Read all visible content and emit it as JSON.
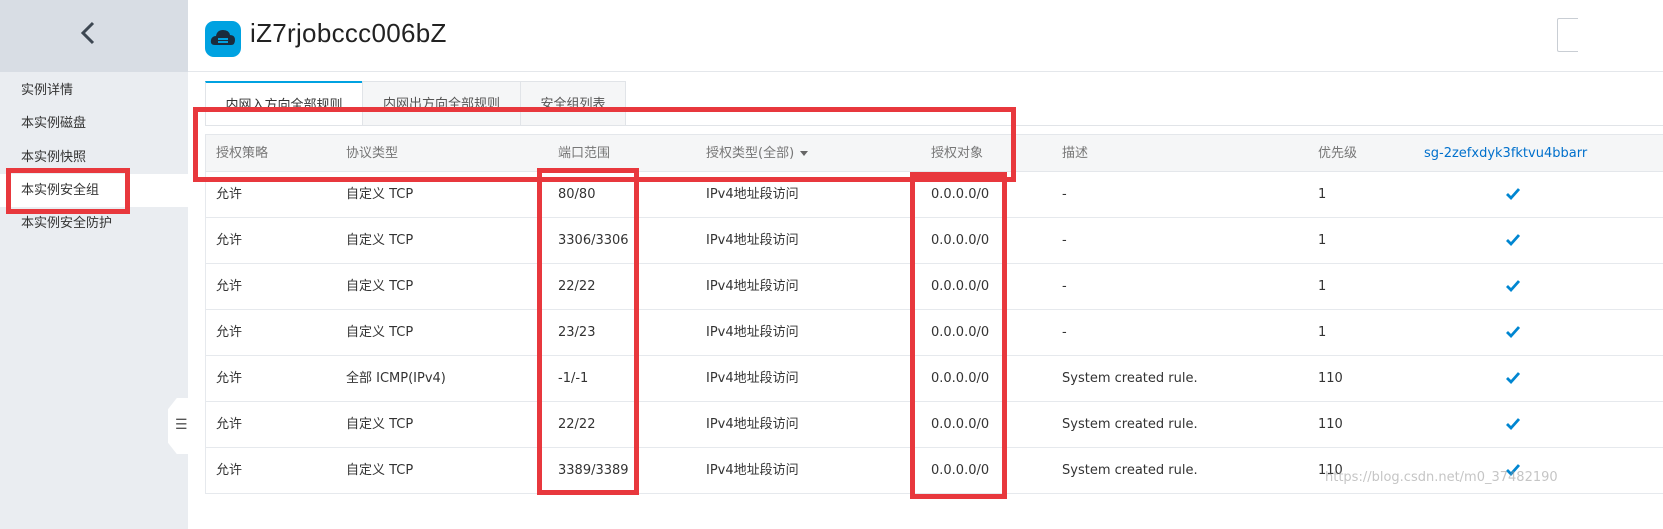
{
  "sidebar": {
    "back_icon": "chevron-left-icon",
    "items": [
      {
        "label": "实例详情"
      },
      {
        "label": "本实例磁盘"
      },
      {
        "label": "本实例快照"
      },
      {
        "label": "本实例安全组"
      },
      {
        "label": "本实例安全防护"
      }
    ],
    "active_index": 3,
    "collapse_icon": "collapse-sidebar-icon"
  },
  "header": {
    "title": "iZ7rjobccc006bZ",
    "icon": "cloud-server-icon",
    "icon_color": "#00a2e1"
  },
  "tabs": [
    {
      "label": "内网入方向全部规则",
      "active": true
    },
    {
      "label": "内网出方向全部规则",
      "active": false
    },
    {
      "label": "安全组列表",
      "active": false
    }
  ],
  "table": {
    "columns": [
      "授权策略",
      "协议类型",
      "端口范围",
      "授权类型(全部)",
      "授权对象",
      "描述",
      "优先级",
      "sg-2zefxdyk3fktvu4bbarr"
    ],
    "rows": [
      {
        "policy": "允许",
        "protocol": "自定义 TCP",
        "port": "80/80",
        "auth_type": "IPv4地址段访问",
        "target": "0.0.0.0/0",
        "desc": "-",
        "priority": "1"
      },
      {
        "policy": "允许",
        "protocol": "自定义 TCP",
        "port": "3306/3306",
        "auth_type": "IPv4地址段访问",
        "target": "0.0.0.0/0",
        "desc": "-",
        "priority": "1"
      },
      {
        "policy": "允许",
        "protocol": "自定义 TCP",
        "port": "22/22",
        "auth_type": "IPv4地址段访问",
        "target": "0.0.0.0/0",
        "desc": "-",
        "priority": "1"
      },
      {
        "policy": "允许",
        "protocol": "自定义 TCP",
        "port": "23/23",
        "auth_type": "IPv4地址段访问",
        "target": "0.0.0.0/0",
        "desc": "-",
        "priority": "1"
      },
      {
        "policy": "允许",
        "protocol": "全部 ICMP(IPv4)",
        "port": "-1/-1",
        "auth_type": "IPv4地址段访问",
        "target": "0.0.0.0/0",
        "desc": "System created rule.",
        "priority": "110"
      },
      {
        "policy": "允许",
        "protocol": "自定义 TCP",
        "port": "22/22",
        "auth_type": "IPv4地址段访问",
        "target": "0.0.0.0/0",
        "desc": "System created rule.",
        "priority": "110"
      },
      {
        "policy": "允许",
        "protocol": "自定义 TCP",
        "port": "3389/3389",
        "auth_type": "IPv4地址段访问",
        "target": "0.0.0.0/0",
        "desc": "System created rule.",
        "priority": "110"
      }
    ],
    "check_icon": "checkmark-icon",
    "check_color": "#0086d1"
  },
  "annotation_color": "#e8383d",
  "watermark": "https://blog.csdn.net/m0_37482190"
}
